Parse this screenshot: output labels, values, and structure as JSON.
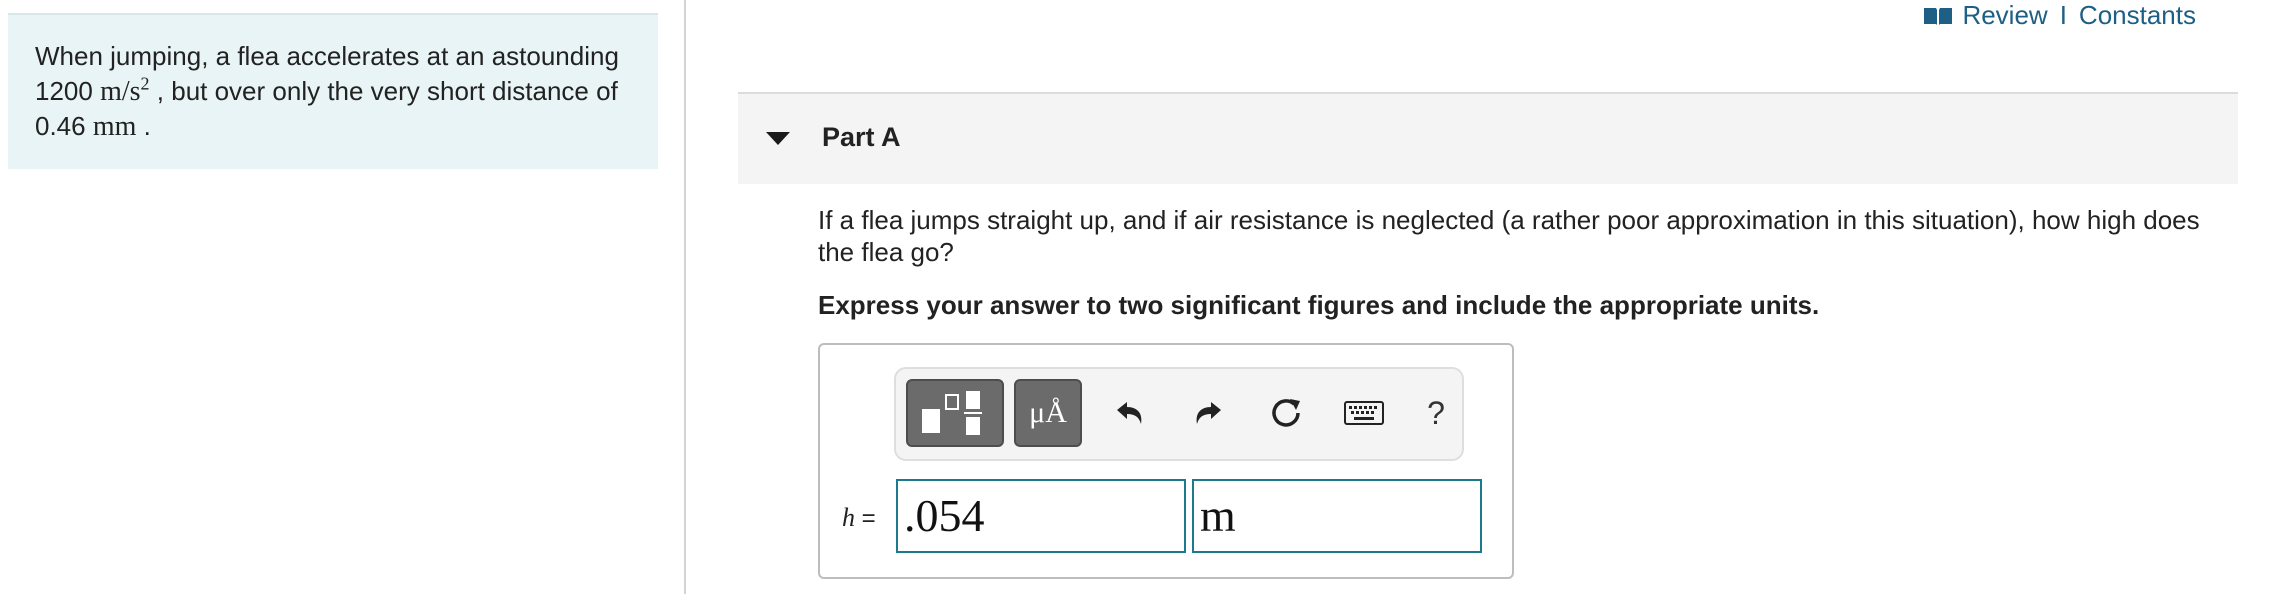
{
  "problem": {
    "text_before": "When jumping, a flea accelerates at an astounding",
    "accel_value": "1200",
    "accel_unit": "m/s",
    "accel_exp": "2",
    "text_middle": ", but over only the very short distance of",
    "distance_value": "0.46",
    "distance_unit": "mm",
    "text_end": "."
  },
  "top_links": {
    "review": "Review",
    "separator": "I",
    "constants": "Constants"
  },
  "part": {
    "title": "Part A",
    "question": "If a flea jumps straight up, and if air resistance is neglected (a rather poor approximation in this situation), how high does the flea go?",
    "instruction": "Express your answer to two significant figures and include the appropriate units."
  },
  "toolbar": {
    "units_label": "μÅ",
    "help_label": "?"
  },
  "answer": {
    "variable": "h",
    "equals": "=",
    "value": ".054",
    "unit": "m"
  },
  "colors": {
    "link": "#1d5f85",
    "panel_bg": "#e8f4f6",
    "field_border": "#1d7a8c"
  }
}
